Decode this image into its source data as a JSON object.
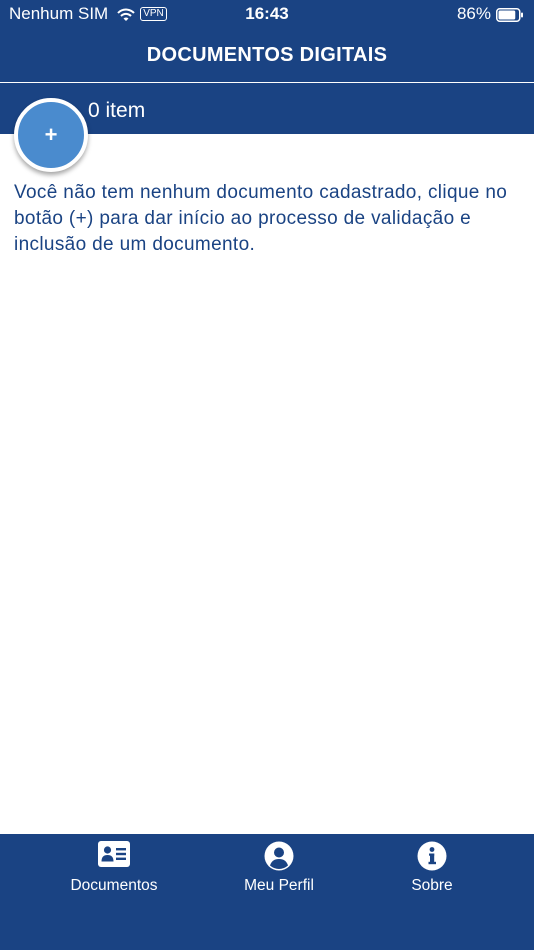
{
  "status_bar": {
    "carrier": "Nenhum SIM",
    "vpn": "VPN",
    "time": "16:43",
    "battery": "86%",
    "battery_level": 0.86
  },
  "header": {
    "title": "DOCUMENTOS DIGITAIS"
  },
  "list": {
    "count_label": "0 item",
    "add_label": "+",
    "empty_message": "Você não tem nenhum documento cadastrado, clique no botão (+) para dar início ao processo de validação e inclusão de um documento."
  },
  "tabs": [
    {
      "label": "Documentos",
      "icon": "id-card-icon"
    },
    {
      "label": "Meu Perfil",
      "icon": "user-circle-icon"
    },
    {
      "label": "Sobre",
      "icon": "info-circle-icon"
    }
  ],
  "colors": {
    "primary": "#1a4383",
    "fab": "#4a8bce",
    "background": "#ffffff"
  }
}
